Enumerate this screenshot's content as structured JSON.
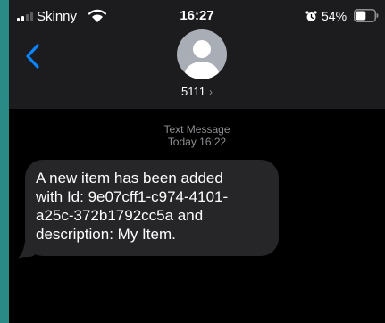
{
  "status_bar": {
    "carrier": "Skinny",
    "time": "16:27",
    "battery_percent": "54%",
    "battery_level": 0.54,
    "signal_bars_active": 2,
    "icons": [
      "signal-icon",
      "wifi-icon",
      "alarm-icon",
      "battery-icon"
    ]
  },
  "header": {
    "back_icon": "chevron-left-icon",
    "avatar_icon": "person-icon",
    "contact_name": "5111",
    "contact_chevron": "›"
  },
  "conversation": {
    "service_label": "Text Message",
    "timestamp": "Today 16:22",
    "messages": [
      {
        "direction": "incoming",
        "text": "A new item has been added\nwith Id: 9e07cff1-c974-4101-\na25c-372b1792cc5a and\ndescription: My Item."
      }
    ]
  },
  "colors": {
    "background": "#000000",
    "header_background": "#1c1c1e",
    "incoming_bubble": "#262628",
    "accent_blue": "#0a84ff",
    "secondary_text": "#8e8e93",
    "frame": "#2a8a85"
  }
}
